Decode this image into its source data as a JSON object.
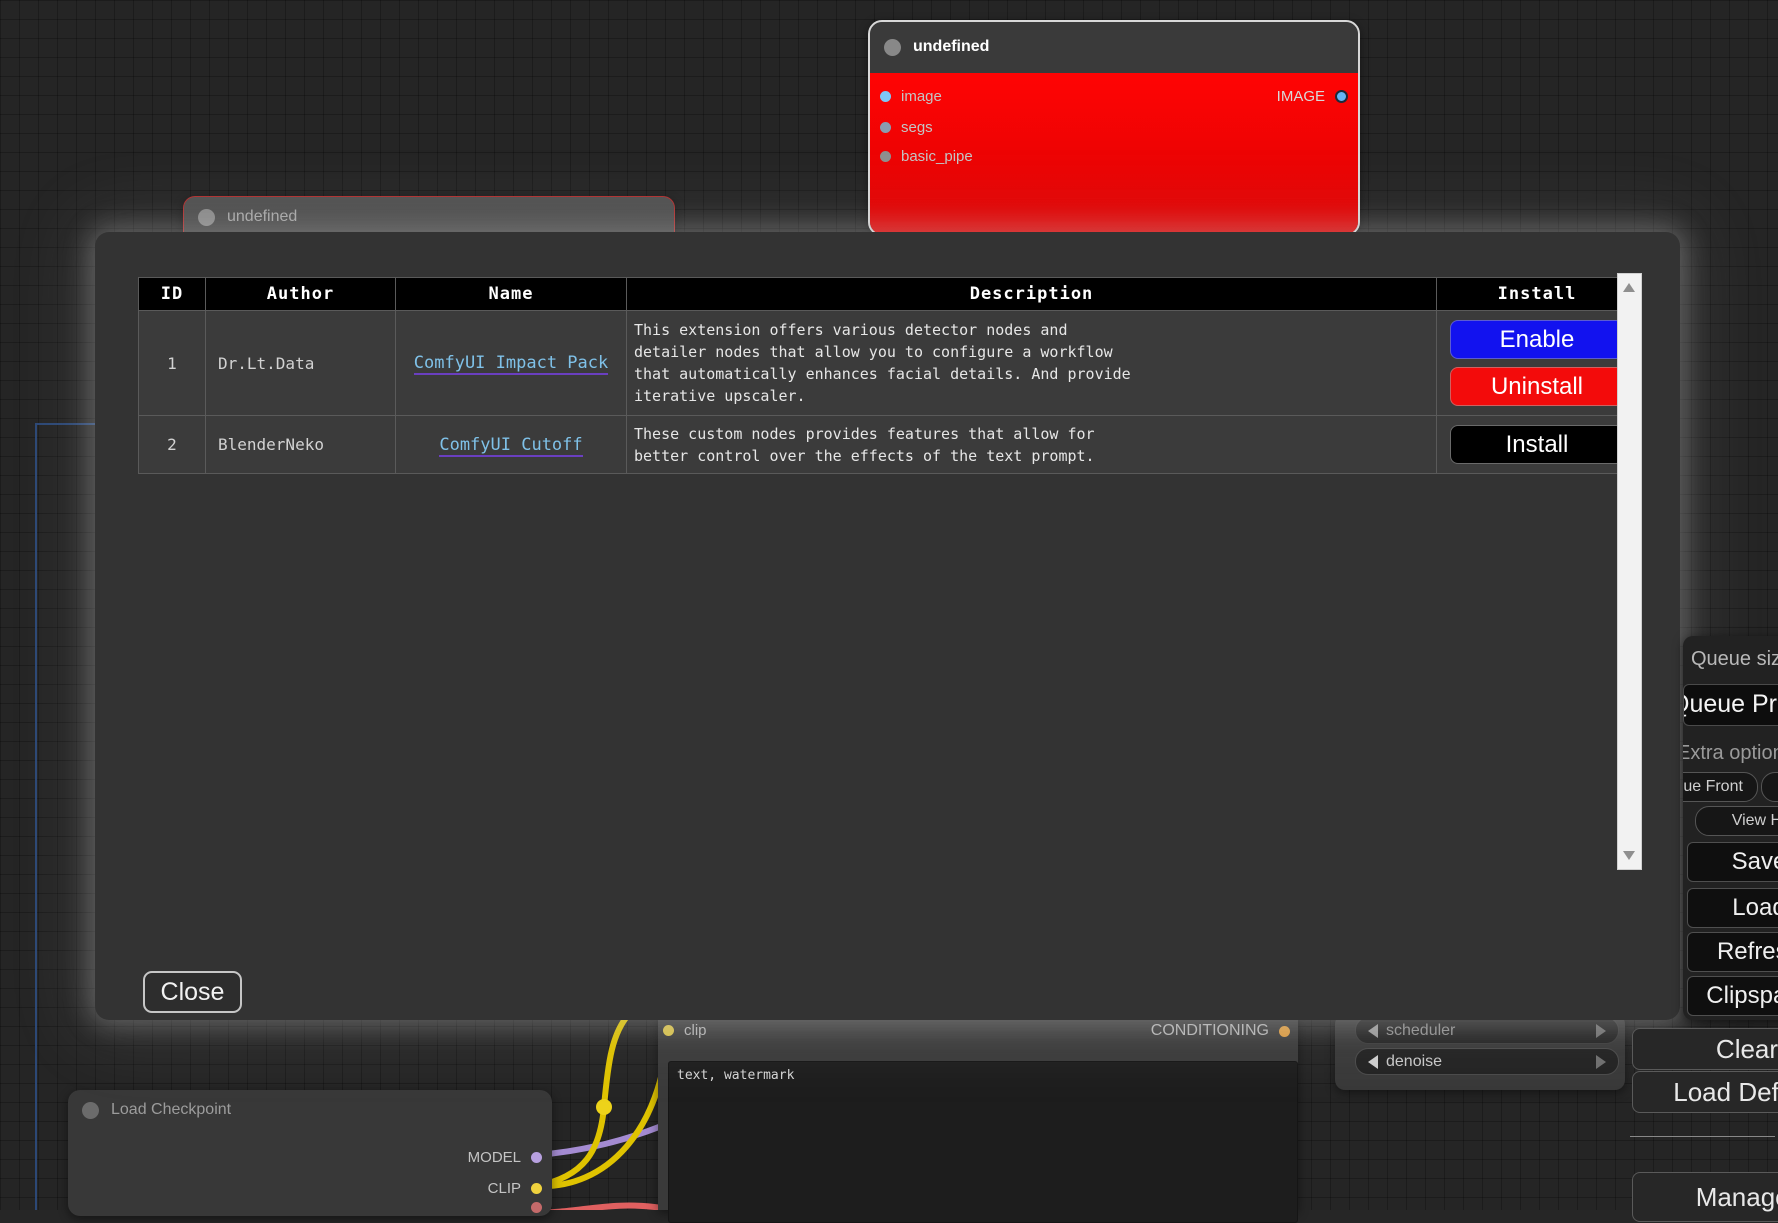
{
  "colors": {
    "enable_button": "#1212ef",
    "uninstall_button": "#f30b0b",
    "install_button": "#000000",
    "error_node_body": "#ff0404",
    "link_text": "#7fc1e8",
    "link_underline": "#6a3fc0",
    "wire_clip": "#dfc300",
    "wire_model": "#a48bd2",
    "wire_vae": "#e06060",
    "group_outline": "#2d4d80"
  },
  "modal": {
    "close_label": "Close",
    "table": {
      "headers": [
        "ID",
        "Author",
        "Name",
        "Description",
        "Install"
      ],
      "rows": [
        {
          "id": "1",
          "author": "Dr.Lt.Data",
          "name": "ComfyUI Impact Pack",
          "description": "This extension offers various detector nodes and detailer nodes that allow you to configure a workflow that automatically enhances facial details. And provide iterative upscaler.",
          "buttons": [
            {
              "label": "Enable"
            },
            {
              "label": "Uninstall"
            }
          ]
        },
        {
          "id": "2",
          "author": "BlenderNeko",
          "name": "ComfyUI Cutoff",
          "description": "These custom nodes provides features that allow for better control over the effects of the text prompt.",
          "buttons": [
            {
              "label": "Install"
            }
          ]
        }
      ]
    }
  },
  "canvas": {
    "error_node": {
      "title": "undefined",
      "inputs": [
        "image",
        "segs",
        "basic_pipe"
      ],
      "output": "IMAGE"
    },
    "ghost_node": {
      "title": "undefined"
    },
    "checkpoint_node": {
      "title": "Load Checkpoint",
      "outputs": [
        "MODEL",
        "CLIP"
      ]
    },
    "clip_node": {
      "input": "clip",
      "output": "CONDITIONING",
      "text_value": "text, watermark"
    },
    "sampler_node": {
      "widgets": [
        "scheduler",
        "denoise"
      ]
    }
  },
  "sidebar": {
    "queue_size_label": "Queue size:",
    "queue_prompt_label": "Queue Prompt",
    "extra_options_label": "Extra options",
    "queue_front_label": "Queue Front",
    "view_history_label": "View History",
    "buttons": [
      "Save",
      "Load",
      "Refresh",
      "Clipspace"
    ],
    "clear_label": "Clear",
    "load_default_label": "Load Default",
    "manager_label": "Manager"
  }
}
